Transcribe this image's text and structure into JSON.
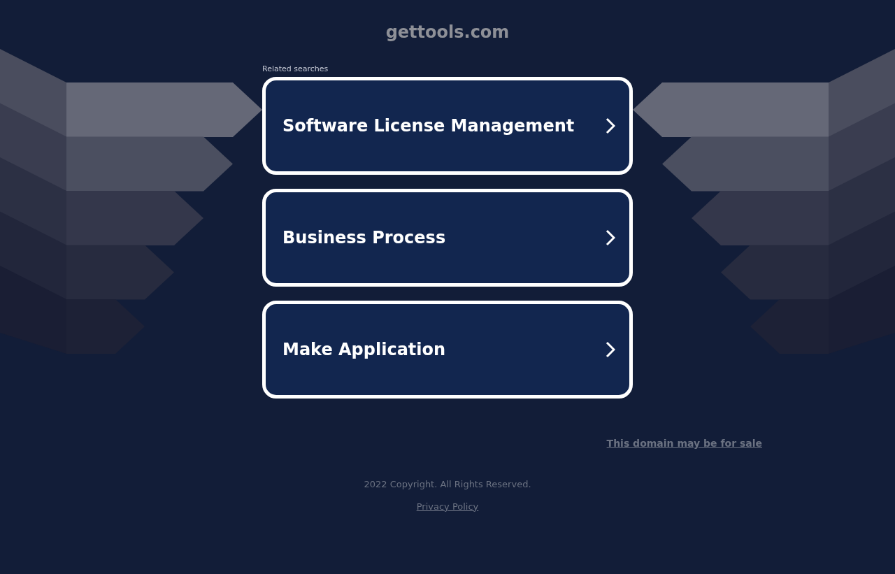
{
  "title": "gettools.com",
  "related_label": "Related searches",
  "searches": [
    {
      "label": "Software License Management"
    },
    {
      "label": "Business Process"
    },
    {
      "label": "Make Application"
    }
  ],
  "sale_link": "This domain may be for sale",
  "copyright": "2022 Copyright. All Rights Reserved.",
  "privacy_link": "Privacy Policy"
}
